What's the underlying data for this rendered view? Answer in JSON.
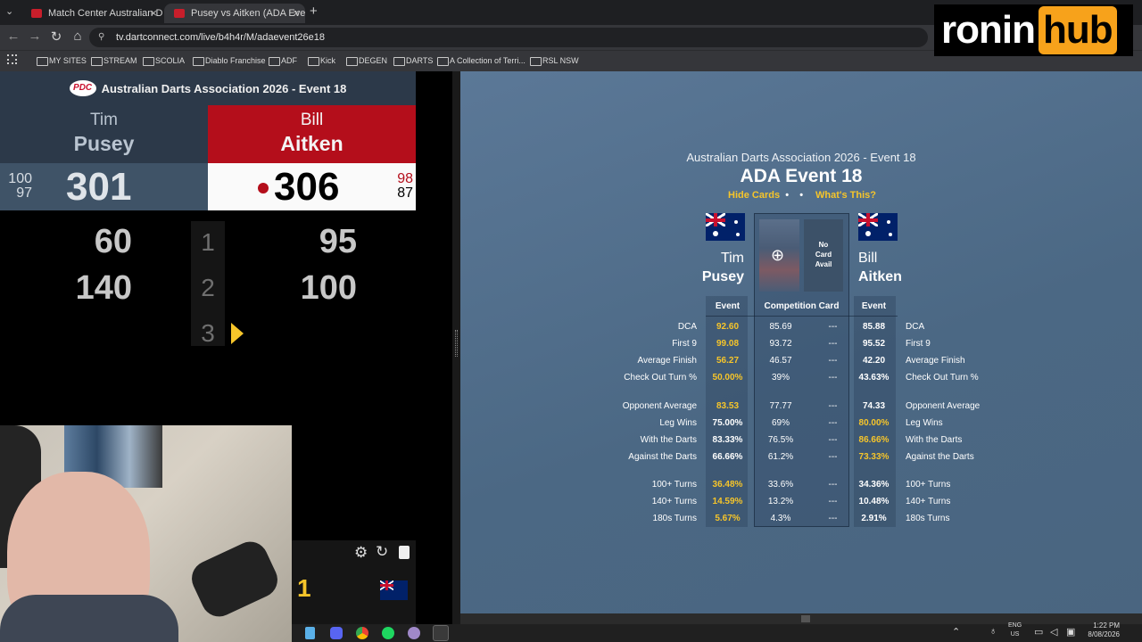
{
  "browser": {
    "tabs": [
      {
        "title": "Match Center Australian Darts"
      },
      {
        "title": "Pusey vs Aitken (ADA Event 18)"
      }
    ],
    "url": "tv.dartconnect.com/live/b4h4r/M/adaevent26e18",
    "bookmarks": [
      "MY SITES",
      "STREAM",
      "SCOLIA",
      "Diablo Franchise",
      "ADF",
      "Kick",
      "DEGEN",
      "DARTS",
      "A Collection of Terri...",
      "RSL NSW"
    ]
  },
  "logo": {
    "word": "ronin",
    "highlight": "hub"
  },
  "scoreboard": {
    "event_title": "Australian Darts Association 2026 - Event 18",
    "pdc_badge": "PDC",
    "player1": {
      "first": "Tim",
      "last": "Pusey",
      "score": "301",
      "avg_top": "100",
      "avg_bottom": "97",
      "turns": [
        "60",
        "140"
      ]
    },
    "player2": {
      "first": "Bill",
      "last": "Aitken",
      "score": "306",
      "avg_top": "98",
      "avg_bottom": "87",
      "turns": [
        "95",
        "100"
      ]
    },
    "legs": [
      "1",
      "2",
      "3"
    ],
    "bottom_leg": "1"
  },
  "stats": {
    "subtitle": "Australian Darts Association 2026 - Event 18",
    "title": "ADA Event 18",
    "hide_cards": "Hide Cards",
    "whats_this": "What's This?",
    "p1": {
      "first": "Tim",
      "last": "Pusey"
    },
    "p2": {
      "first": "Bill",
      "last": "Aitken"
    },
    "no_card": [
      "No",
      "Card",
      "Avail"
    ],
    "headers": {
      "event": "Event",
      "card": "Competition Card",
      "event2": "Event"
    },
    "rows": [
      {
        "label": "DCA",
        "p1": "92.60",
        "card": "85.69",
        "dash": "---",
        "p2": "85.88",
        "p1_hi": true,
        "p2_hi": false
      },
      {
        "label": "First 9",
        "p1": "99.08",
        "card": "93.72",
        "dash": "---",
        "p2": "95.52",
        "p1_hi": true,
        "p2_hi": false
      },
      {
        "label": "Average Finish",
        "p1": "56.27",
        "card": "46.57",
        "dash": "---",
        "p2": "42.20",
        "p1_hi": true,
        "p2_hi": false
      },
      {
        "label": "Check Out Turn %",
        "p1": "50.00%",
        "card": "39%",
        "dash": "---",
        "p2": "43.63%",
        "p1_hi": true,
        "p2_hi": false
      },
      {
        "label": "Opponent Average",
        "p1": "83.53",
        "card": "77.77",
        "dash": "---",
        "p2": "74.33",
        "p1_hi": true,
        "p2_hi": false
      },
      {
        "label": "Leg Wins",
        "p1": "75.00%",
        "card": "69%",
        "dash": "---",
        "p2": "80.00%",
        "p1_hi": false,
        "p2_hi": true
      },
      {
        "label": "With the Darts",
        "p1": "83.33%",
        "card": "76.5%",
        "dash": "---",
        "p2": "86.66%",
        "p1_hi": false,
        "p2_hi": true
      },
      {
        "label": "Against the Darts",
        "p1": "66.66%",
        "card": "61.2%",
        "dash": "---",
        "p2": "73.33%",
        "p1_hi": false,
        "p2_hi": true
      },
      {
        "label": "100+ Turns",
        "p1": "36.48%",
        "card": "33.6%",
        "dash": "---",
        "p2": "34.36%",
        "p1_hi": true,
        "p2_hi": false
      },
      {
        "label": "140+ Turns",
        "p1": "14.59%",
        "card": "13.2%",
        "dash": "---",
        "p2": "10.48%",
        "p1_hi": true,
        "p2_hi": false
      },
      {
        "label": "180s Turns",
        "p1": "5.67%",
        "card": "4.3%",
        "dash": "---",
        "p2": "2.91%",
        "p1_hi": true,
        "p2_hi": false
      }
    ]
  },
  "taskbar": {
    "lang1": "ENG",
    "lang2": "US",
    "time": "1:22 PM",
    "date": "8/08/2026"
  },
  "colors": {
    "accent_yellow": "#f6c52a",
    "red": "#b40e1b",
    "navy": "#2c3949"
  }
}
